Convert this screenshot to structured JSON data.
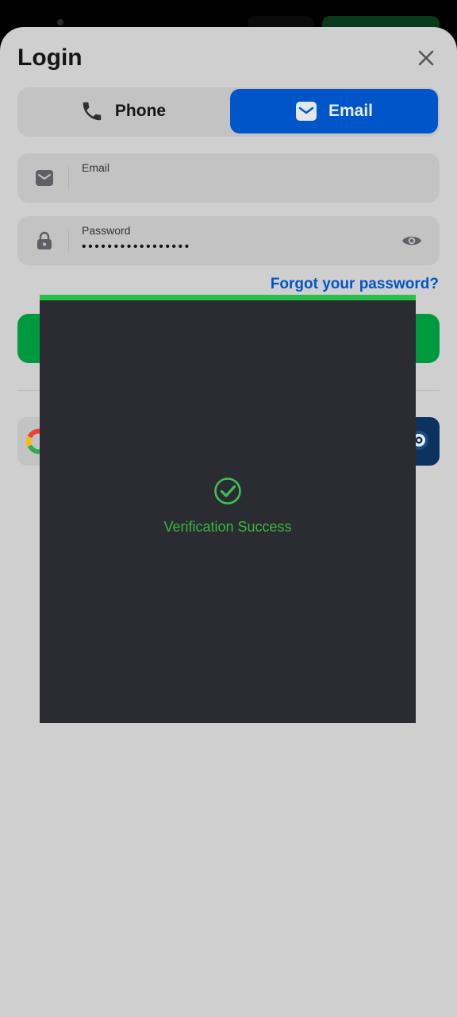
{
  "title": "Login",
  "tabs": [
    {
      "label": "Phone",
      "icon": "phone-icon",
      "active": false
    },
    {
      "label": "Email",
      "icon": "mail-icon",
      "active": true
    }
  ],
  "form": {
    "email_label": "Email",
    "email_value": "",
    "password_label": "Password",
    "password_value": "•••••••••••••••••",
    "forgot_link": "Forgot your password?"
  },
  "social": [
    "google-icon",
    "steam-icon"
  ],
  "captcha": {
    "status_text": "Verification Success",
    "progress": 1.0,
    "progress_color": "#28c24a"
  },
  "colors": {
    "accent": "#0055c9",
    "login_button": "#009a3e",
    "success": "#36b93e",
    "overlay": "#2a2c31"
  }
}
